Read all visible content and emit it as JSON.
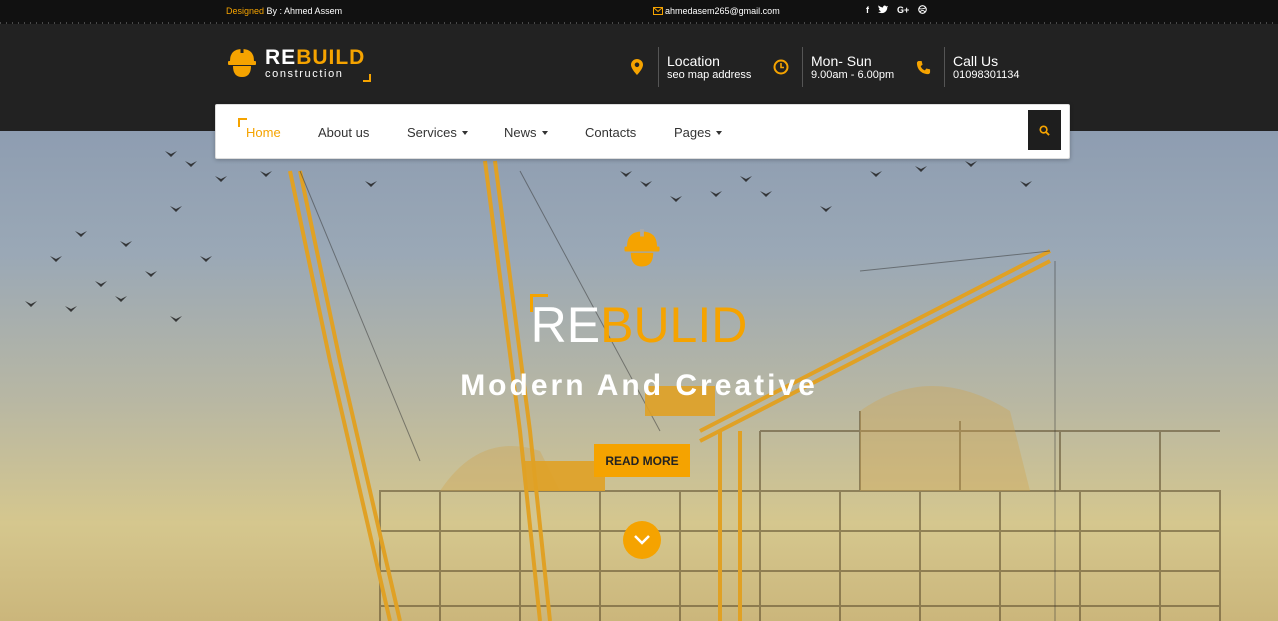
{
  "topbar": {
    "designed_prefix": "Designed",
    "designed_suffix": " By : Ahmed Assem",
    "email": "ahmedasem265@gmail.com",
    "social": [
      "f",
      "t",
      "G+",
      "dribbble"
    ]
  },
  "brand": {
    "name_white": "RE",
    "name_accent": "BUILD",
    "tagline": "construction",
    "accent_color": "#f5a300"
  },
  "header": {
    "location": {
      "title": "Location",
      "detail": "seo map address",
      "icon": "map-marker-icon"
    },
    "hours": {
      "title": "Mon- Sun",
      "detail": "9.00am - 6.00pm",
      "icon": "clock-icon"
    },
    "call": {
      "title": "Call Us",
      "detail": "01098301134",
      "icon": "phone-icon"
    }
  },
  "nav": {
    "items": [
      {
        "label": "Home",
        "active": true
      },
      {
        "label": "About us"
      },
      {
        "label": "Services",
        "dropdown": true
      },
      {
        "label": "News",
        "dropdown": true
      },
      {
        "label": "Contacts"
      },
      {
        "label": "Pages",
        "dropdown": true
      }
    ],
    "search_icon": "search-icon"
  },
  "hero": {
    "title_white": "RE",
    "title_accent": "BULID",
    "subtitle": "Modern And Creative",
    "button": "READ MORE",
    "scroll_icon": "chevron-down-icon"
  }
}
